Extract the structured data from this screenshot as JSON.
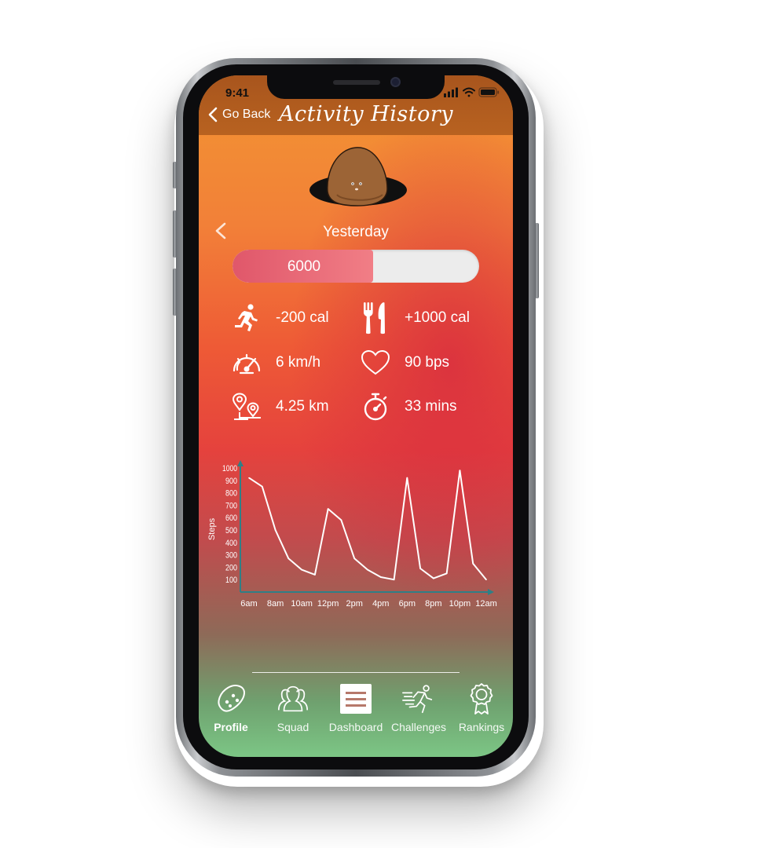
{
  "status_bar": {
    "time": "9:41"
  },
  "header": {
    "back_label": "Go Back",
    "title": "Activity History"
  },
  "day": {
    "label": "Yesterday"
  },
  "progress": {
    "value_label": "6000",
    "fill_fraction": 0.57
  },
  "stats": [
    {
      "icon": "running-icon",
      "value": "-200 cal"
    },
    {
      "icon": "fork-knife-icon",
      "value": "+1000 cal"
    },
    {
      "icon": "speedometer-icon",
      "value": "6 km/h"
    },
    {
      "icon": "heart-icon",
      "value": "90 bps"
    },
    {
      "icon": "map-pin-icon",
      "value": "4.25 km"
    },
    {
      "icon": "stopwatch-icon",
      "value": "33 mins"
    }
  ],
  "chart_data": {
    "type": "line",
    "ylabel": "Steps",
    "ylim": [
      0,
      1000
    ],
    "yticks": [
      "100",
      "200",
      "300",
      "400",
      "500",
      "600",
      "700",
      "800",
      "900",
      "1000"
    ],
    "xtick_labels": [
      "6am",
      "8am",
      "10am",
      "12pm",
      "2pm",
      "4pm",
      "6pm",
      "8pm",
      "10pm",
      "12am"
    ],
    "x": [
      6,
      7,
      8,
      9,
      10,
      11,
      12,
      13,
      14,
      15,
      16,
      17,
      18,
      19,
      20,
      21,
      22,
      23,
      24
    ],
    "values": [
      920,
      850,
      500,
      270,
      180,
      140,
      670,
      580,
      270,
      180,
      120,
      100,
      920,
      190,
      110,
      150,
      980,
      230,
      100
    ],
    "grid": false,
    "line_color": "#ffffff",
    "axis_color": "#2f7f86"
  },
  "tabs": [
    {
      "label": "Profile",
      "icon": "potato-icon",
      "active": true
    },
    {
      "label": "Squad",
      "icon": "group-icon",
      "active": false
    },
    {
      "label": "Dashboard",
      "icon": "dashboard-icon",
      "active": false
    },
    {
      "label": "Challenges",
      "icon": "sprinter-icon",
      "active": false
    },
    {
      "label": "Rankings",
      "icon": "award-ribbon-icon",
      "active": false
    }
  ]
}
